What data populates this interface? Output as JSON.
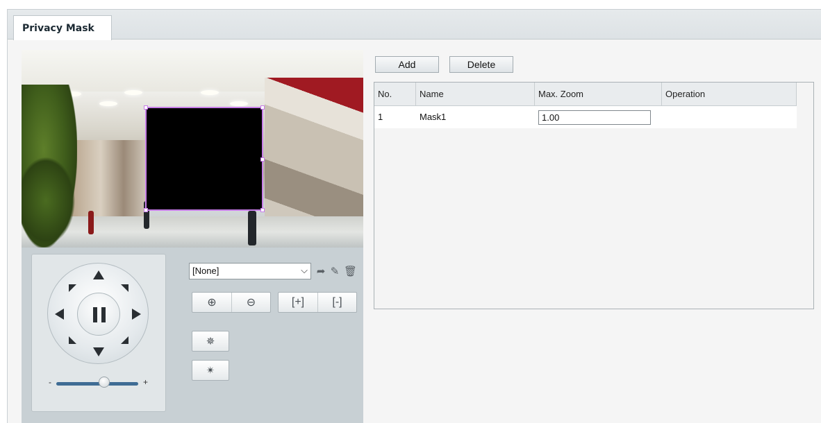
{
  "tab": {
    "title": "Privacy Mask"
  },
  "ptz": {
    "preset_selected": "[None]",
    "zoom_minus_label": "-",
    "zoom_plus_label": "+"
  },
  "actions": {
    "add_label": "Add",
    "delete_label": "Delete"
  },
  "table": {
    "headers": [
      "No.",
      "Name",
      "Max. Zoom",
      "Operation"
    ],
    "rows": [
      {
        "no": "1",
        "name": "Mask1",
        "max_zoom": "1.00",
        "operation": ""
      }
    ]
  },
  "colors": {
    "mask_border": "#c77de8",
    "panel_bg": "#c8d0d4"
  },
  "icons": {
    "preset_call": "arrow-forward-icon",
    "preset_edit": "pencil-icon",
    "preset_delete": "trash-icon",
    "zoom_in": "zoom-in-icon",
    "zoom_out": "zoom-out-icon",
    "focus_near": "focus-near-icon",
    "focus_far": "focus-far-icon",
    "light": "light-icon",
    "wiper": "wiper-icon"
  }
}
